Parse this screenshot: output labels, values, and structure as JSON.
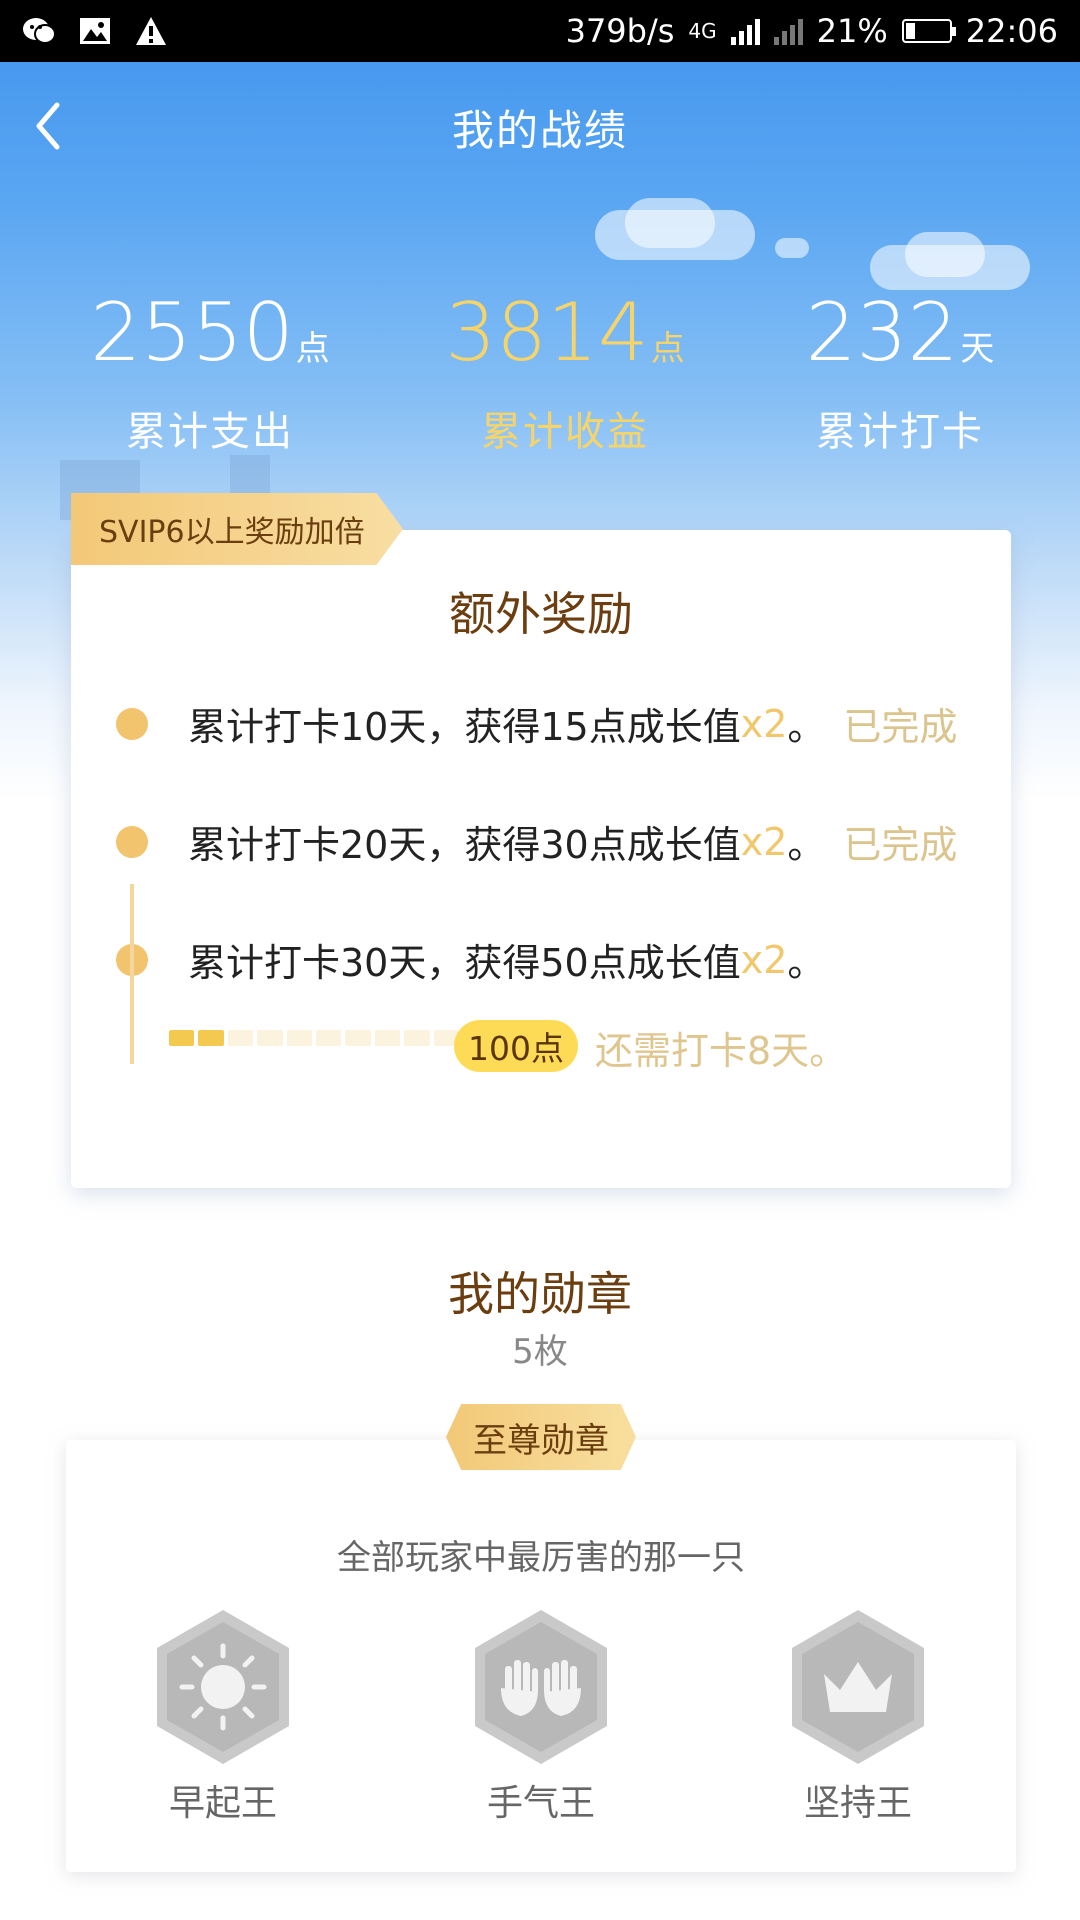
{
  "status_bar": {
    "speed": "379b/s",
    "network": "4G",
    "battery": "21%",
    "time": "22:06",
    "icons": [
      "wechat-icon",
      "image-icon",
      "warning-icon"
    ]
  },
  "nav": {
    "title": "我的战绩"
  },
  "stats": [
    {
      "value": "2550",
      "unit": "点",
      "label": "累计支出"
    },
    {
      "value": "3814",
      "unit": "点",
      "label": "累计收益"
    },
    {
      "value": "232",
      "unit": "天",
      "label": "累计打卡"
    }
  ],
  "reward": {
    "tag": "SVIP6以上奖励加倍",
    "title": "额外奖励",
    "rows": [
      {
        "text": "累计打卡10天，获得15点成长值",
        "mult": "x2",
        "end": "。",
        "status": "已完成"
      },
      {
        "text": "累计打卡20天，获得30点成长值",
        "mult": "x2",
        "end": "。",
        "status": "已完成"
      },
      {
        "text": "累计打卡30天，获得50点成长值",
        "mult": "x2",
        "end": "。",
        "status": ""
      }
    ],
    "progress_segments_total": 10,
    "progress_segments_done": 2,
    "bubble": "100点",
    "remaining": "还需打卡8天。"
  },
  "medals": {
    "title": "我的勋章",
    "count": "5枚",
    "tag": "至尊勋章",
    "subtitle": "全部玩家中最厉害的那一只",
    "items": [
      {
        "label": "早起王",
        "icon": "sun-icon"
      },
      {
        "label": "手气王",
        "icon": "hands-icon"
      },
      {
        "label": "坚持王",
        "icon": "crown-icon"
      }
    ]
  }
}
